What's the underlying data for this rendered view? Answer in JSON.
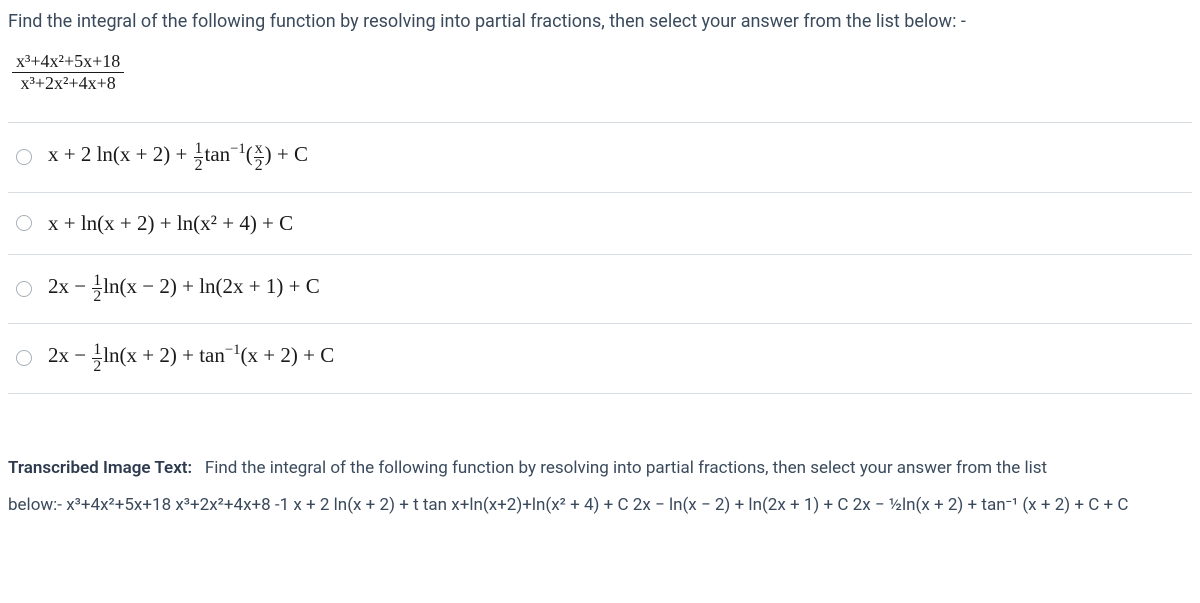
{
  "question": "Find the integral of the following function by resolving into partial fractions, then select your answer from the list below: -",
  "integrand": {
    "numerator": "x³+4x²+5x+18",
    "denominator": "x³+2x²+4x+8"
  },
  "options": [
    {
      "id": "a",
      "html": "x + 2 ln(x + 2) + <span class='sfrac'><span class='sn'>1</span><span class='sd'>2</span></span>tan<span class='sup'>−1</span>(<span class='sfrac'><span class='sn'>x</span><span class='sd'>2</span></span>) + C"
    },
    {
      "id": "b",
      "html": "x + ln(x + 2) + ln(x² + 4) + C"
    },
    {
      "id": "c",
      "html": "2x − <span class='sfrac'><span class='sn'>1</span><span class='sd'>2</span></span>ln(x − 2) + ln(2x + 1) + C"
    },
    {
      "id": "d",
      "html": "2x − <span class='sfrac'><span class='sn'>1</span><span class='sd'>2</span></span>ln(x + 2) + tan<span class='sup'>−1</span>(x + 2) + C"
    }
  ],
  "transcribed": {
    "title": "Transcribed Image Text:",
    "body": "Find the integral of the following function by resolving into partial fractions, then select your answer from the list",
    "body2": "below:- x³+4x²+5x+18 x³+2x²+4x+8 -1 x + 2 ln(x + 2) + t tan x+ln(x+2)+ln(x² + 4) + C 2x − ln(x − 2) + ln(2x + 1) + C 2x − ½ln(x + 2) + tan⁻¹ (x + 2) + C + C"
  }
}
